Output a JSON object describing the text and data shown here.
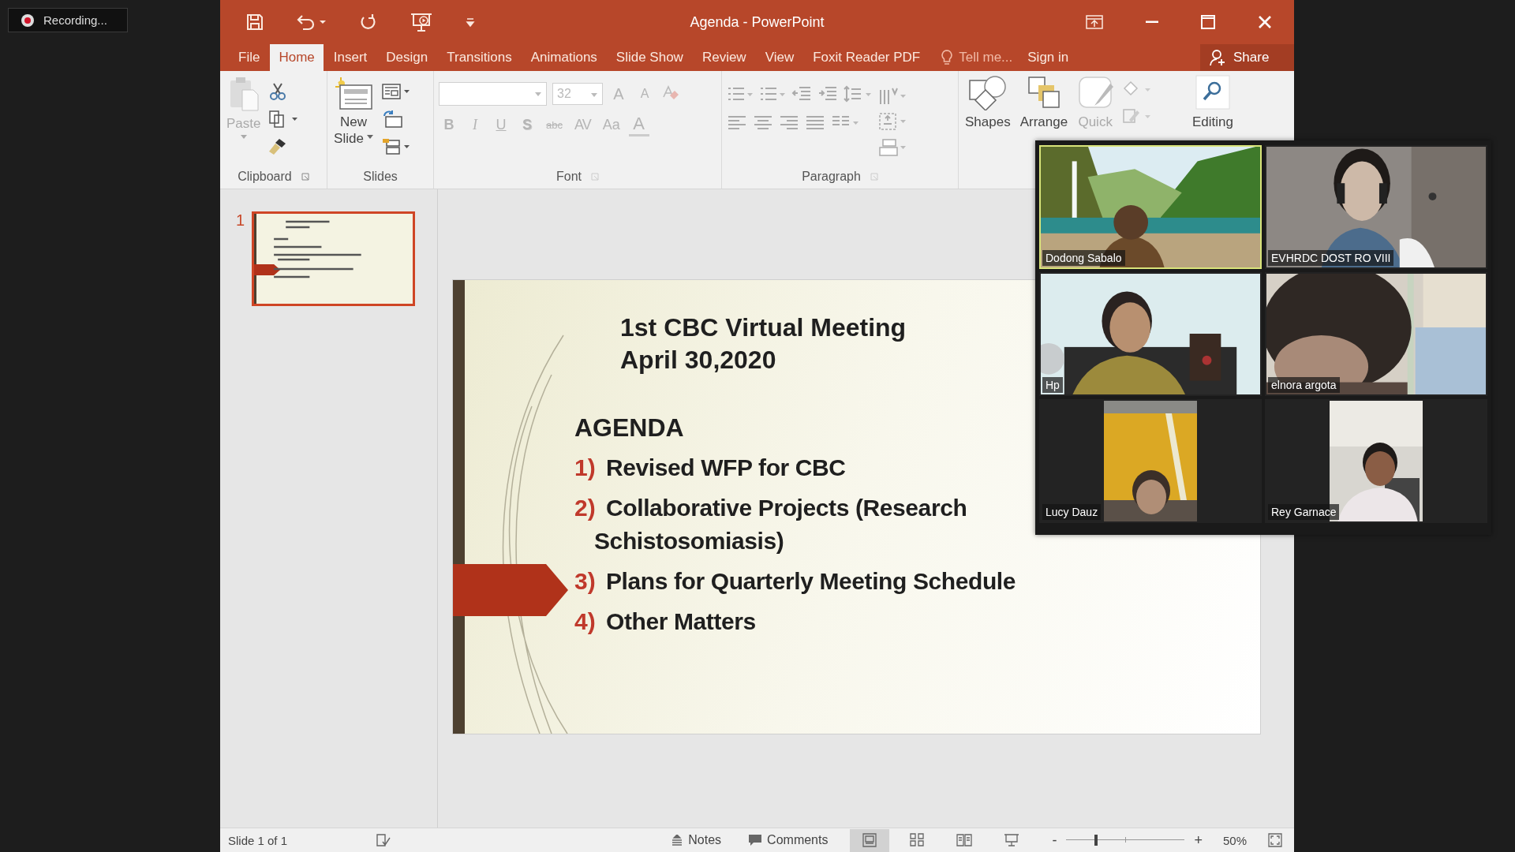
{
  "recording": {
    "label": "Recording..."
  },
  "window": {
    "title": "Agenda - PowerPoint"
  },
  "tabs": [
    {
      "label": "File",
      "selected": false
    },
    {
      "label": "Home",
      "selected": true
    },
    {
      "label": "Insert",
      "selected": false
    },
    {
      "label": "Design",
      "selected": false
    },
    {
      "label": "Transitions",
      "selected": false
    },
    {
      "label": "Animations",
      "selected": false
    },
    {
      "label": "Slide Show",
      "selected": false
    },
    {
      "label": "Review",
      "selected": false
    },
    {
      "label": "View",
      "selected": false
    },
    {
      "label": "Foxit Reader PDF",
      "selected": false
    }
  ],
  "tell_me": "Tell me...",
  "sign_in": "Sign in",
  "share": "Share",
  "ribbon": {
    "clipboard": {
      "paste": {
        "label": "Paste",
        "disabled": true
      },
      "group": "Clipboard"
    },
    "slides": {
      "new_slide": [
        "New",
        "Slide"
      ],
      "group": "Slides"
    },
    "font": {
      "size_field": {
        "value": "32"
      },
      "row1": [
        {
          "kind": "grow",
          "label": "A",
          "disabled": true
        },
        {
          "kind": "shrink",
          "label": "A",
          "disabled": true
        }
      ],
      "row2": [
        {
          "kind": "bold",
          "label": "B",
          "disabled": true
        },
        {
          "kind": "italic",
          "label": "I",
          "disabled": true
        },
        {
          "kind": "underline",
          "label": "U",
          "disabled": true
        },
        {
          "kind": "shadow",
          "label": "S",
          "disabled": true
        },
        {
          "kind": "strike",
          "label": "abc",
          "disabled": true
        },
        {
          "kind": "spacing",
          "label": "AV",
          "disabled": true
        },
        {
          "kind": "case",
          "label": "Aa",
          "disabled": true
        },
        {
          "kind": "color",
          "label": "A",
          "disabled": true
        }
      ],
      "group": "Font"
    },
    "paragraph": {
      "group": "Paragraph"
    },
    "drawing": {
      "shapes": {
        "label": "Shapes",
        "disabled": false
      },
      "arrange": {
        "label": "Arrange",
        "disabled": false
      },
      "quick_styles": {
        "label": "Quick",
        "disabled": true
      }
    },
    "editing": {
      "label": "Editing"
    }
  },
  "slide_thumbnails": [
    {
      "number": "1",
      "selected": true
    }
  ],
  "slide": {
    "title_lines": [
      "1st CBC Virtual Meeting",
      "April 30,2020"
    ],
    "heading": "AGENDA",
    "items": [
      {
        "number": "1)",
        "lines": [
          "Revised WFP for CBC"
        ]
      },
      {
        "number": "2)",
        "lines": [
          "Collaborative Projects (Research",
          "Schistosomiasis)"
        ]
      },
      {
        "number": "3)",
        "lines": [
          "Plans for Quarterly Meeting Schedule"
        ]
      },
      {
        "number": "4)",
        "lines": [
          "Other Matters"
        ]
      }
    ]
  },
  "video_tiles": [
    {
      "name": "Dodong Sabalo",
      "kind": "wide",
      "speaking": true
    },
    {
      "name": "EVHRDC DOST RO VIII",
      "kind": "wide",
      "speaking": false
    },
    {
      "name": "Hp",
      "kind": "wide",
      "speaking": false
    },
    {
      "name": "elnora argota",
      "kind": "wide",
      "speaking": false
    },
    {
      "name": "Lucy Dauz",
      "kind": "narrow",
      "speaking": false
    },
    {
      "name": "Rey Garnace",
      "kind": "narrow",
      "speaking": false
    }
  ],
  "status_bar": {
    "slide_count": "Slide 1 of 1",
    "notes": "Notes",
    "comments": "Comments",
    "views": [
      {
        "selected": true
      },
      {
        "selected": false
      },
      {
        "selected": false
      },
      {
        "selected": false
      }
    ],
    "zoom_out": "-",
    "zoom_in": "+",
    "zoom": {
      "level": 0.25
    },
    "zoom_percent": "50%"
  }
}
